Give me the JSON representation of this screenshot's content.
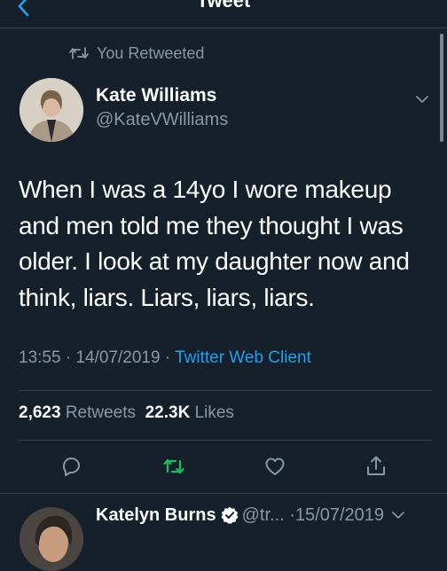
{
  "header": {
    "title": "Tweet",
    "back_icon": "chevron-left-icon"
  },
  "retweet_context": {
    "label": "You Retweeted",
    "icon": "retweet-icon"
  },
  "tweet": {
    "author_name": "Kate Williams",
    "author_handle": "@KateVWilliams",
    "text": "When I was a 14yo I wore makeup and men told me they thought I was older. I look at my daughter now and think, liars. Liars, liars, liars.",
    "time": "13:55",
    "date": "14/07/2019",
    "client": "Twitter Web Client",
    "separator": "·",
    "retweets_count": "2,623",
    "retweets_label": "Retweets",
    "likes_count": "22.3K",
    "likes_label": "Likes"
  },
  "actions": [
    "reply-icon",
    "retweet-icon",
    "like-icon",
    "share-icon"
  ],
  "next_tweet": {
    "author_name": "Katelyn Burns",
    "handle_truncated": "@tr...",
    "date": "·15/07/2019"
  },
  "colors": {
    "background": "#15202b",
    "secondary_text": "#8899a6",
    "accent": "#1da1f2",
    "retweet_green": "#17bf63",
    "divider": "#38444d"
  }
}
